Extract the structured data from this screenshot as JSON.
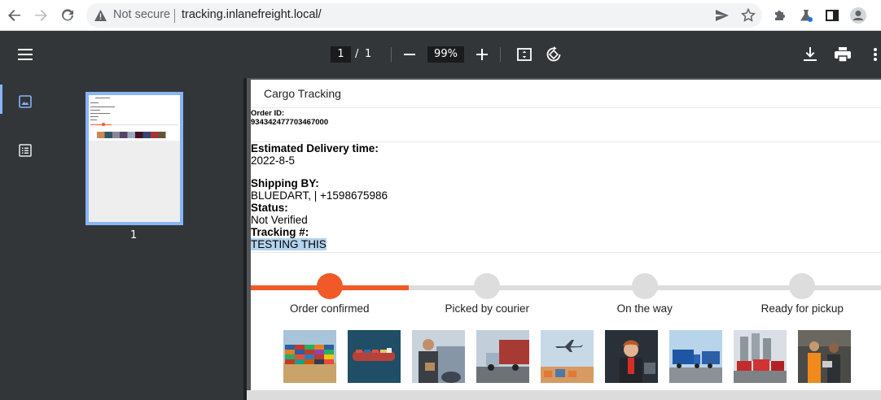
{
  "browser": {
    "security_label": "Not secure",
    "url": "tracking.inlanefreight.local/"
  },
  "pdf_toolbar": {
    "current_page": "1",
    "page_separator": "/",
    "total_pages": "1",
    "zoom": "99%"
  },
  "sidebar": {
    "thumbnail_page_number": "1"
  },
  "document": {
    "title": "Cargo Tracking",
    "order_id_label": "Order ID:",
    "order_id_value": "934342477703467000",
    "delivery_label": "Estimated Delivery time:",
    "delivery_value": "2022-8-5",
    "shipping_label": "Shipping BY:",
    "shipping_value": "BLUEDART, | +1598675986",
    "status_label": "Status:",
    "status_value": "Not Verified",
    "tracking_label": "Tracking #:",
    "tracking_value": "TESTING THIS",
    "progress_fraction": 0.25,
    "steps": [
      {
        "label": "Order confirmed",
        "active": true
      },
      {
        "label": "Picked by courier",
        "active": false
      },
      {
        "label": "On the way",
        "active": false
      },
      {
        "label": "Ready for pickup",
        "active": false
      }
    ],
    "photos": [
      {
        "name": "shipping-containers-photo"
      },
      {
        "name": "cargo-ship-photo"
      },
      {
        "name": "courier-man-photo"
      },
      {
        "name": "truck-photo"
      },
      {
        "name": "cargo-plane-photo"
      },
      {
        "name": "truck-driver-woman-photo"
      },
      {
        "name": "blue-trucks-photo"
      },
      {
        "name": "red-trucks-photo"
      },
      {
        "name": "warehouse-workers-photo"
      }
    ]
  },
  "colors": {
    "accent": "#f05a28",
    "inactive": "#dddddd",
    "viewer_bg": "#323639",
    "thumb_highlight": "#8ab4f8"
  }
}
